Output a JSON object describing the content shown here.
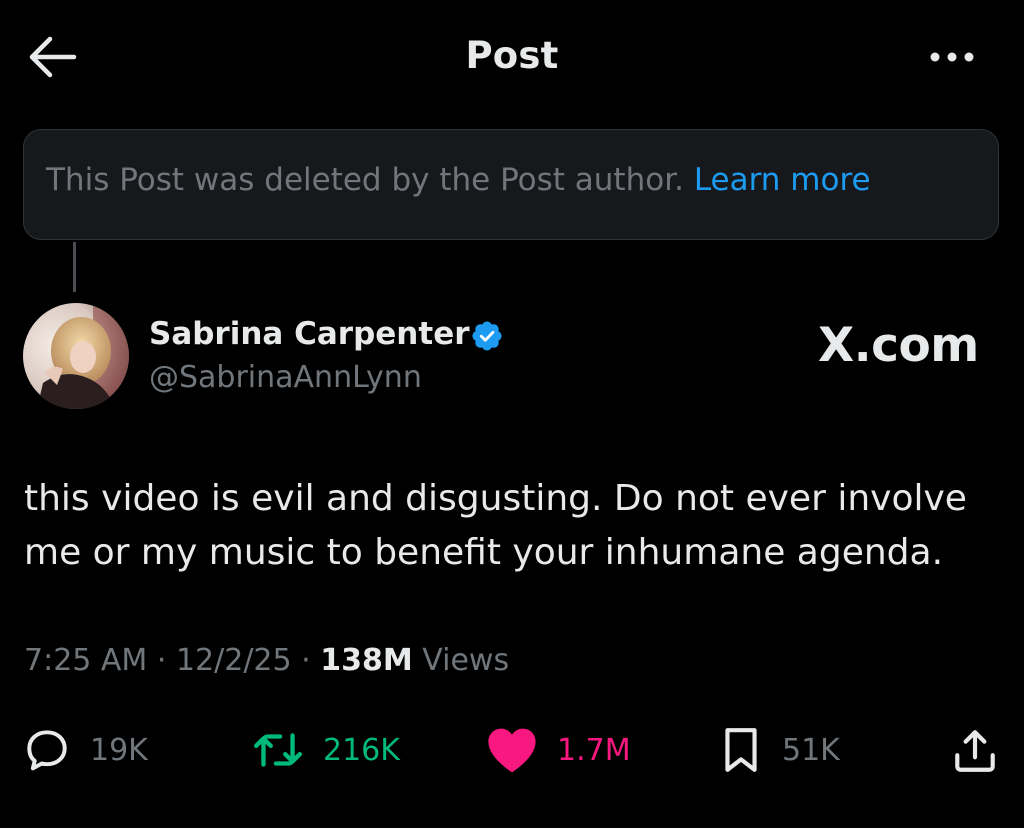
{
  "header": {
    "title": "Post",
    "back_icon": "arrow-left-icon",
    "more_icon": "more-horizontal-icon"
  },
  "deleted_notice": {
    "text": "This Post was deleted by the Post author.",
    "link": "Learn more"
  },
  "author": {
    "name": "Sabrina Carpenter",
    "handle": "@SabrinaAnnLynn",
    "verified": true
  },
  "watermark": "X.com",
  "post": {
    "line1": "this video is evil and disgusting. Do not ever involve",
    "line2": "me or my music to benefit your inhumane agenda."
  },
  "meta": {
    "time": "7:25 AM",
    "date": "12/2/25",
    "views_count": "138M",
    "views_label": "Views",
    "separator": "·"
  },
  "actions": {
    "replies": "19K",
    "reposts": "216K",
    "likes": "1.7M",
    "bookmarks": "51K"
  },
  "colors": {
    "background": "#000000",
    "text_primary": "#e7e9ea",
    "text_secondary": "#71767b",
    "link": "#1d9bf0",
    "verified": "#1d9bf0",
    "repost": "#00ba7c",
    "like": "#f91880"
  }
}
